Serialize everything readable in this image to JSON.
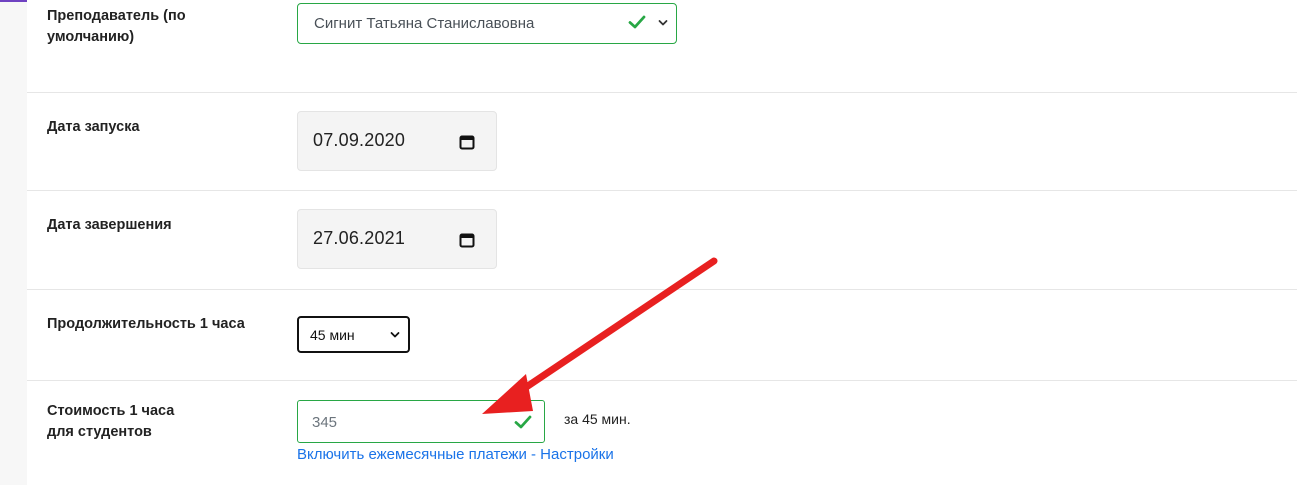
{
  "fields": {
    "teacher": {
      "label": "Преподаватель (по умолчанию)",
      "value": "Сигнит Татьяна Станиславовна"
    },
    "start_date": {
      "label": "Дата запуска",
      "value": "07.09.2020"
    },
    "end_date": {
      "label": "Дата завершения",
      "value": "27.06.2021"
    },
    "duration": {
      "label": "Продолжительность 1 часа",
      "value": "45 мин"
    },
    "price": {
      "label_line1": "Стоимость 1 часа",
      "label_line2": "для студентов",
      "value": "345",
      "suffix": "за 45 мин.",
      "link": "Включить ежемесячные платежи - Настройки"
    }
  },
  "icons": {
    "valid": "check-icon",
    "dropdown": "chevron-down-icon",
    "date": "calendar-icon",
    "annotation": "red-arrow"
  },
  "colors": {
    "valid": "#28a745",
    "link": "#1a73e8",
    "annotation": "#e82020",
    "accent_line": "#6f42c1"
  }
}
